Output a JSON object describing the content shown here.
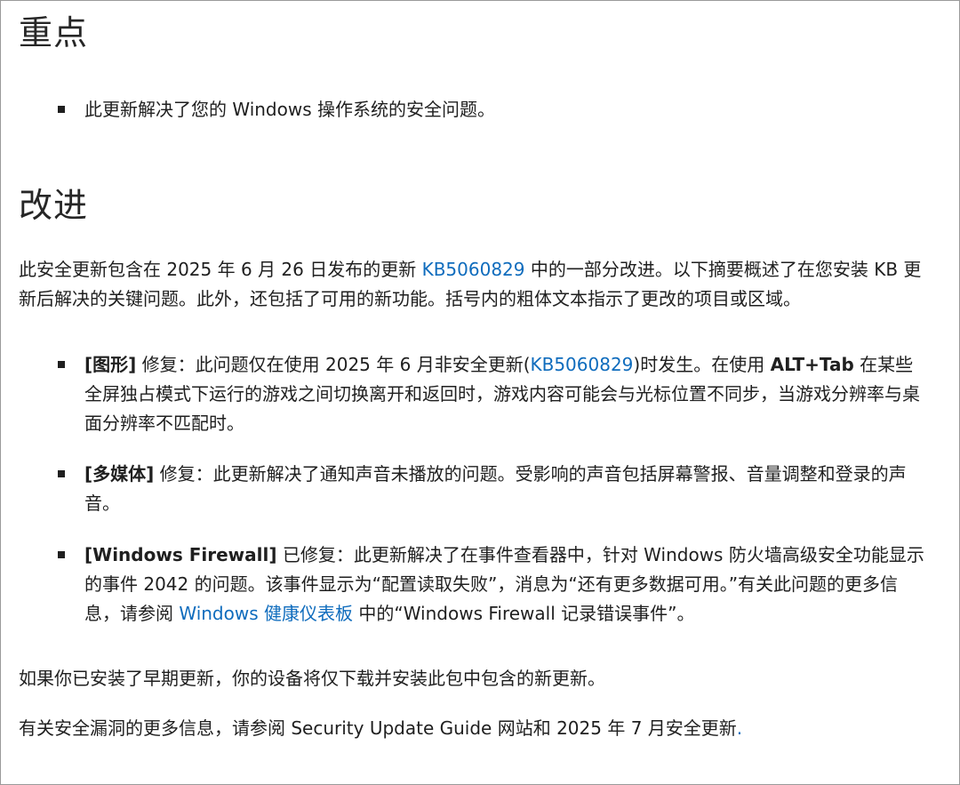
{
  "highlights": {
    "title": "重点",
    "items": [
      "此更新解决了您的 Windows 操作系统的安全问题。"
    ]
  },
  "improvements": {
    "title": "改进",
    "intro": {
      "before": "此安全更新包含在 2025 年 6 月 26 日发布的更新 ",
      "link": "KB5060829",
      "after": " 中的一部分改进。以下摘要概述了在您安装 KB 更新后解决的关键问题。此外，还包括了可用的新功能。括号内的粗体文本指示了更改的项目或区域。"
    },
    "items": [
      {
        "tag": "[图形]",
        "t1": " 修复：此问题仅在使用 2025 年 6 月非安全更新(",
        "link": "KB5060829",
        "t2": ")时发生。在使用 ",
        "key": "ALT+Tab",
        "t3": " 在某些全屏独占模式下运行的游戏之间切换离开和返回时，游戏内容可能会与光标位置不同步，当游戏分辨率与桌面分辨率不匹配时。"
      },
      {
        "tag": "[多媒体]",
        "t1": " 修复：此更新解决了通知声音未播放的问题。受影响的声音包括屏幕警报、音量调整和登录的声音。"
      },
      {
        "tag": "[Windows Firewall]",
        "t1": " 已修复：此更新解决了在事件查看器中，针对 Windows 防火墙高级安全功能显示的事件 2042 的问题。该事件显示为“配置读取失败”，消息为“还有更多数据可用。”有关此问题的更多信息，请参阅 ",
        "link": "Windows 健康仪表板",
        "t2": " 中的“Windows Firewall 记录错误事件”。"
      }
    ]
  },
  "footer": {
    "p1": "如果你已安装了早期更新，你的设备将仅下载并安装此包中包含的新更新。",
    "p2_text": "有关安全漏洞的更多信息，请参阅 Security Update Guide 网站和 2025 年 7 月安全更新",
    "p2_link": "."
  },
  "colors": {
    "link": "#0f6cbd",
    "text": "#1f1f1f",
    "border": "#9a9a9a"
  }
}
